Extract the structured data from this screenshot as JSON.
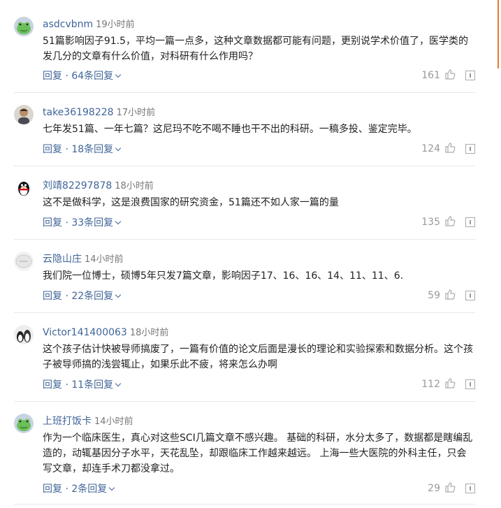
{
  "comments": [
    {
      "user": "asdcvbnm",
      "time": "19小时前",
      "text": "51篇影响因子91.5，平均一篇一点多，这种文章数据都可能有问题，更别说学术价值了，医学类的发几分的文章有什么价值，对科研有什么作用吗？",
      "reply": "回复",
      "reply_count": "64条回复",
      "likes": "161",
      "avatar": "frog-avatar"
    },
    {
      "user": "take36198228",
      "time": "17小时前",
      "text": "七年发51篇、一年七篇？这尼玛不吃不喝不睡也干不出的科研。一稿多投、鉴定完毕。",
      "reply": "回复",
      "reply_count": "18条回复",
      "likes": "124",
      "avatar": "person-avatar"
    },
    {
      "user": "刘靖82297878",
      "time": "18小时前",
      "text": "这不是做科学，这是浪费国家的研究资金，51篇还不如人家一篇的量",
      "reply": "回复",
      "reply_count": "33条回复",
      "likes": "135",
      "avatar": "penguin-avatar"
    },
    {
      "user": "云隐山庄",
      "time": "14小时前",
      "text": "我们院一位博士，硕博5年只发7篇文章，影响因子17、16、16、14、11、11、6.",
      "reply": "回复",
      "reply_count": "22条回复",
      "likes": "59",
      "avatar": "router-avatar"
    },
    {
      "user": "Victor141400063",
      "time": "18小时前",
      "text": "这个孩子估计快被导师搞废了，一篇有价值的论文后面是漫长的理论和实验探索和数据分析。这个孩子被导师搞的浅尝辄止，如果乐此不疲，将来怎么办啊",
      "reply": "回复",
      "reply_count": "11条回复",
      "likes": "112",
      "avatar": "penguins-avatar"
    },
    {
      "user": "上班打饭卡",
      "time": "14小时前",
      "text": "作为一个临床医生，真心对这些SCI几篇文章不感兴趣。 基础的科研，水分太多了，数据都是瞎编乱造的，动辄基因分子水平，天花乱坠，却跟临床工作越来越远。 上海一些大医院的外科主任，只会写文章，却连手术刀都没拿过。",
      "reply": "回复",
      "reply_count": "2条回复",
      "likes": "29",
      "avatar": "frog-avatar"
    }
  ],
  "colors": {
    "link": "#406599",
    "muted": "#999999",
    "accent": "#e9792b"
  }
}
